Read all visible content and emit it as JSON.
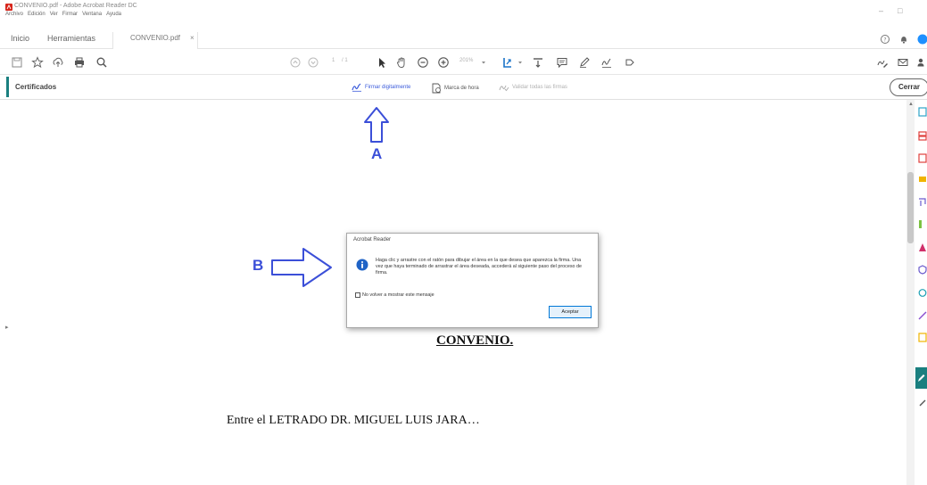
{
  "window": {
    "title": "CONVENIO.pdf - Adobe Acrobat Reader DC",
    "menu": [
      "Archivo",
      "Edición",
      "Ver",
      "Firmar",
      "Ventana",
      "Ayuda"
    ],
    "controls": {
      "minimize": "–",
      "maximize": "□"
    }
  },
  "tabs": [
    {
      "label": "Inicio"
    },
    {
      "label": "Herramientas"
    },
    {
      "label": "CONVENIO.pdf",
      "close": "×"
    }
  ],
  "toolbar": {
    "page_current": "1",
    "page_total": "/ 1",
    "zoom": "201%",
    "icons": [
      "save-icon",
      "star-icon",
      "upload-icon",
      "print-icon",
      "search-icon",
      "page-up-icon",
      "page-down-icon",
      "select-arrow-icon",
      "hand-icon",
      "zoom-out-icon",
      "zoom-in-icon",
      "fit-page-icon",
      "scroll-mode-icon",
      "comment-icon",
      "pen-icon",
      "sign-icon",
      "share-icon",
      "help-icon",
      "bell-icon",
      "profile-icon",
      "sign-top-icon",
      "mail-icon",
      "user-add-icon"
    ]
  },
  "certificados": {
    "title": "Certificados",
    "actions": [
      {
        "label": "Firmar digitalmente",
        "color": "#3b5bdb"
      },
      {
        "label": "Marca de hora",
        "color": "#555555"
      },
      {
        "label": "Validar todas las firmas",
        "color": "#b0b0b0"
      }
    ],
    "close_label": "Cerrar",
    "accent_color": "#1a7f7f"
  },
  "annotations": {
    "a_label": "A",
    "b_label": "B",
    "color": "#3b4fd8"
  },
  "dialog": {
    "title": "Acrobat Reader",
    "message": "Haga clic y arrastre con el ratón para dibujar el área en la que desea que aparezca la firma. Una vez que haya terminado de arrastrar el área deseada, accederá al siguiente paso del proceso de firma.",
    "checkbox_label": "No volver a mostrar este mensaje",
    "checkbox_checked": false,
    "ok_label": "Aceptar"
  },
  "document": {
    "heading": "CONVENIO.",
    "line1": "Entre el LETRADO DR. MIGUEL LUIS JARA…"
  }
}
